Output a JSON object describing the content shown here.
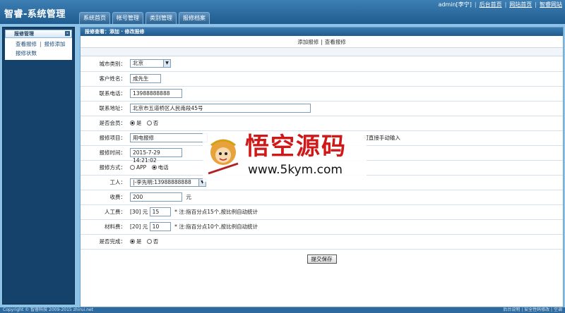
{
  "header": {
    "brand": "智睿-系统管理",
    "tabs": [
      "系统首页",
      "帐号管理",
      "类别管理",
      "报修档案"
    ],
    "user": "admin[李宁]",
    "links": [
      "后台首页",
      "网站首页",
      "智睿网站"
    ]
  },
  "sidebar": {
    "title": "报修管理",
    "items": [
      "查看报修",
      "报修添加",
      "报修状数"
    ]
  },
  "main": {
    "breadcrumb": "报修查看：添加 · 修改报修",
    "subnav": [
      "添加报修",
      "查看报修"
    ]
  },
  "form": {
    "city_label": "城市类别：",
    "city_value": "北京",
    "customer_label": "客户姓名：",
    "customer_value": "成先生",
    "phone_label": "联系电话：",
    "phone_value": "13988888888",
    "address_label": "联系地址：",
    "address_value": "北京市五道桥区人民南段45号",
    "member_label": "是否会员：",
    "member_options": [
      "是",
      "否"
    ],
    "item_label": "报修项目：",
    "item_value": "用电报修",
    "item_hint": "可直接手动输入",
    "time_label": "报修时间：",
    "time_value": "2015-7-29 14:21:02",
    "method_label": "报修方式：",
    "method_options": [
      "APP",
      "电话"
    ],
    "worker_label": "工人：",
    "worker_value": "|-李先明:13988888888",
    "fee_label": "收费：",
    "fee_value": "200",
    "fee_unit": "元",
    "labor_label": "人工费：",
    "labor_base": "[30] 元",
    "labor_value": "15",
    "labor_note": "* 注:指百分点15个,按比例自动统计",
    "material_label": "材料费：",
    "material_base": "[20] 元",
    "material_value": "10",
    "material_note": "* 注:指百分点10个,按比例自动统计",
    "done_label": "是否完成：",
    "done_options": [
      "是",
      "否"
    ],
    "submit": "提交保存"
  },
  "watermark": {
    "title": "悟空源码",
    "url": "www.5kym.com"
  },
  "footer": {
    "left": "Copyright © 智睿科技 2009-2015 zhirui.net",
    "right": "后台说明 | 安全性码修改 | 空调"
  }
}
